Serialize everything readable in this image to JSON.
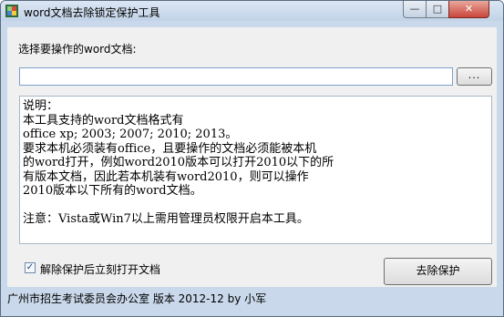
{
  "window": {
    "title": "word文档去除锁定保护工具",
    "minimize_glyph": "—",
    "maximize_glyph": "□",
    "close_glyph": "✕"
  },
  "main": {
    "select_label": "选择要操作的word文档:",
    "path_value": "",
    "browse_label": "...",
    "info_lines": [
      "说明：",
      "本工具支持的word文档格式有",
      "office xp; 2003; 2007; 2010; 2013。",
      "要求本机必须装有office，且要操作的文档必须能被本机",
      "的word打开，例如word2010版本可以打开2010以下的所",
      "有版本文档，因此若本机装有word2010，则可以操作",
      "2010版本以下所有的word文档。",
      "",
      "注意：Vista或Win7以上需用管理员权限开启本工具。"
    ],
    "checkbox_checked": true,
    "checkbox_mark": "✓",
    "checkbox_label": "解除保护后立刻打开文档",
    "remove_button_label": "去除保护"
  },
  "status": {
    "text": "广州市招生考试委员会办公室 版本 2012-12 by 小军"
  },
  "icons": {
    "app": "app-icon"
  }
}
